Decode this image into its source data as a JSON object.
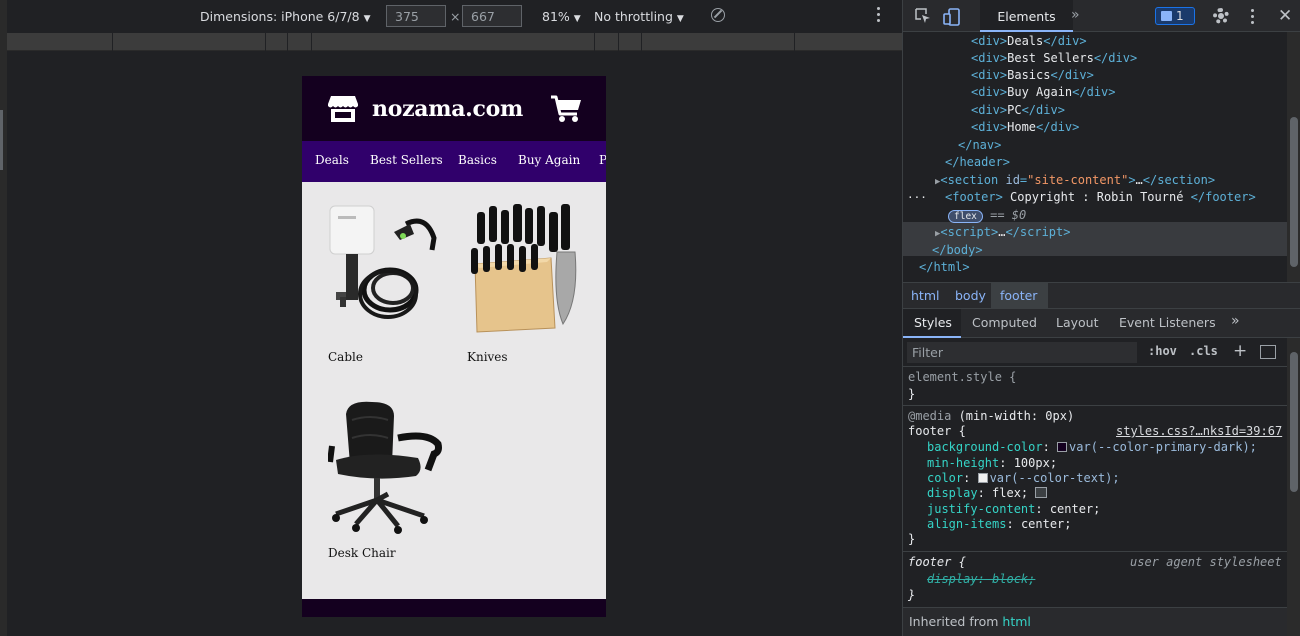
{
  "colors": {
    "header_dark": "#14001f",
    "nav_purple": "#30006b",
    "content_bg": "#e9e8e9",
    "devtools_bg": "#202124",
    "accent_blue": "#8ab4f8"
  },
  "device_toolbar": {
    "dimensions_label": "Dimensions: iPhone 6/7/8",
    "width": "375",
    "height": "667",
    "times": "×",
    "zoom": "81%",
    "throttling": "No throttling",
    "rotate_icon": "rotate-icon",
    "more_icon": "kebab-icon"
  },
  "site": {
    "brand": "nozama.com",
    "nav": [
      "Deals",
      "Best Sellers",
      "Basics",
      "Buy Again",
      "PC"
    ],
    "products": [
      {
        "label": "Cable"
      },
      {
        "label": "Knives"
      },
      {
        "label": "Desk Chair"
      }
    ]
  },
  "devtools": {
    "tab_elements": "Elements",
    "issues_count": "1",
    "close": "✕",
    "dom": {
      "nav_items": [
        "Deals",
        "Best Sellers",
        "Basics",
        "Buy Again",
        "PC",
        "Home"
      ],
      "nav_close": "</nav>",
      "header_close": "</header>",
      "section_tag": "section",
      "section_attr": "id",
      "section_value": "\"site-content\"",
      "section_ellipsis": "…",
      "footer_open": "<footer>",
      "footer_text": " Copyright : Robin Tourné ",
      "footer_close": "</footer>",
      "flex_badge": "flex",
      "eq0": "== $0",
      "script_line": "…",
      "body_close": "</body>",
      "html_close": "</html>"
    },
    "breadcrumbs": [
      "html",
      "body",
      "footer"
    ],
    "sub_tabs": [
      "Styles",
      "Computed",
      "Layout",
      "Event Listeners"
    ],
    "filter_placeholder": "Filter",
    "hov": ":hov",
    "cls": ".cls",
    "styles": {
      "element_style": "element.style {",
      "close_brace": "}",
      "media_at": "@media",
      "media_query": " (min-width: 0px)",
      "footer_selector": "footer {",
      "source_link": "styles.css?…nksId=39:67",
      "props": [
        {
          "name": "background-color",
          "value": "var(--color-primary-dark);",
          "swatch": "#14001f"
        },
        {
          "name": "min-height",
          "value": "100px;"
        },
        {
          "name": "color",
          "value": "var(--color-text);",
          "swatch": "#f1f1f1"
        },
        {
          "name": "display",
          "value": "flex;"
        },
        {
          "name": "justify-content",
          "value": "center;"
        },
        {
          "name": "align-items",
          "value": "center;"
        }
      ],
      "ua_selector": "footer {",
      "ua_label": "user agent stylesheet",
      "ua_prop": "display: block;",
      "inherited_label": "Inherited from ",
      "inherited_link": "html"
    }
  }
}
